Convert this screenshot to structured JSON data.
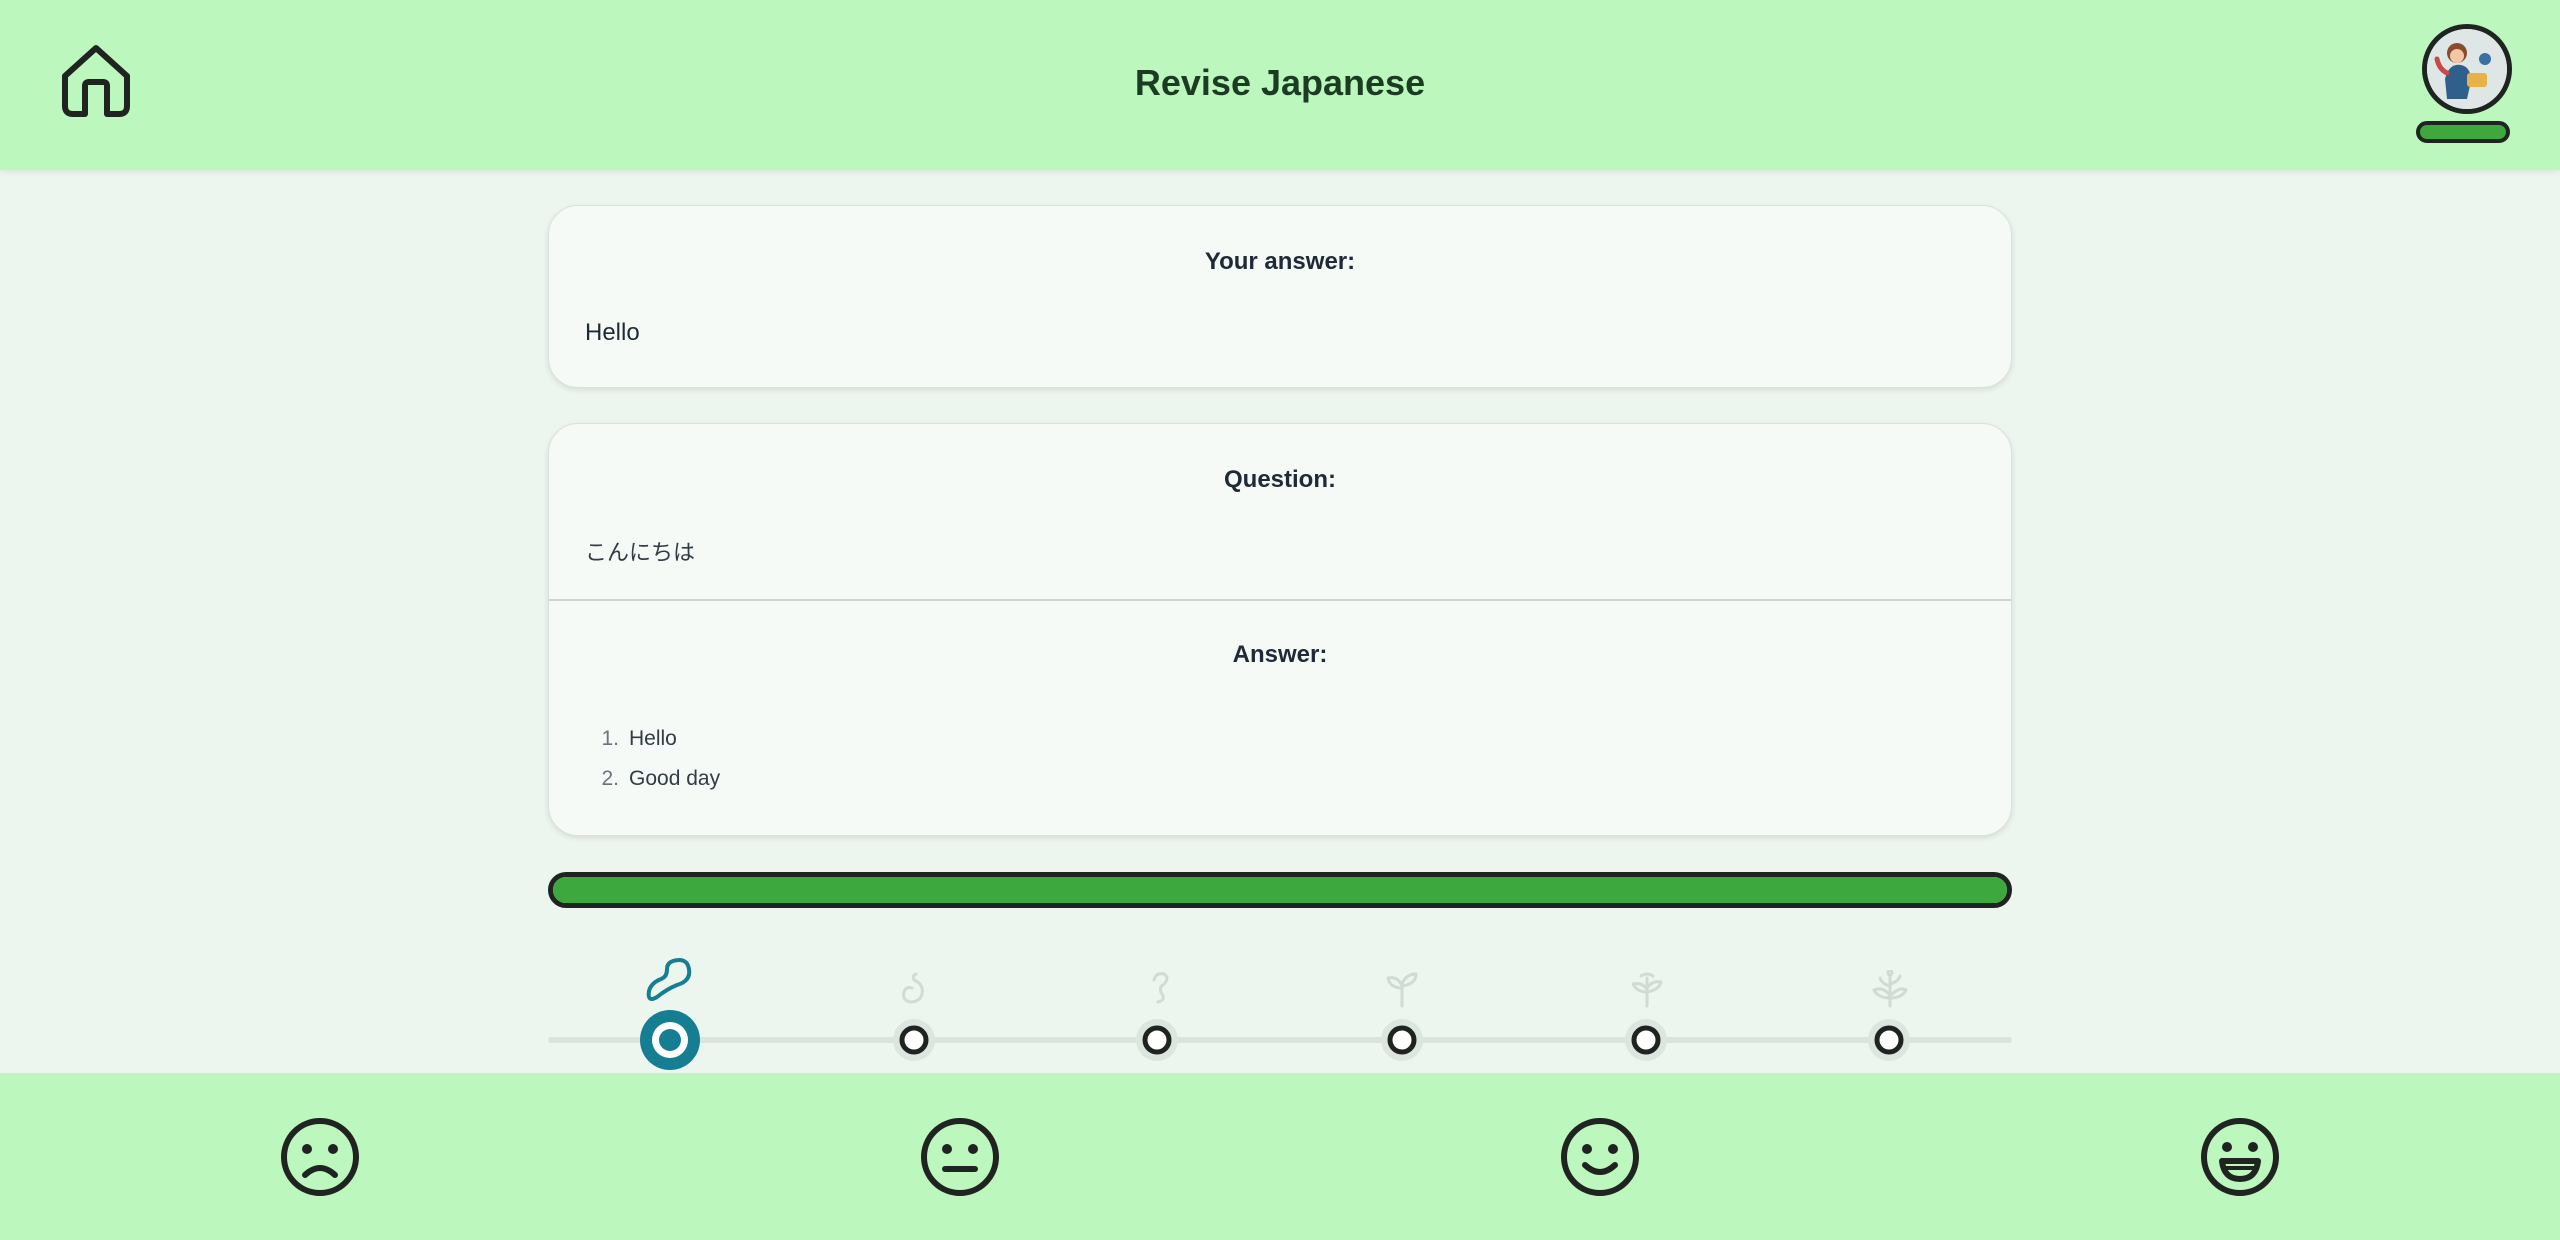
{
  "header": {
    "title": "Revise Japanese",
    "home_icon": "home-icon",
    "avatar": "user-avatar",
    "level_progress": 1.0
  },
  "user_answer": {
    "heading": "Your answer:",
    "text": "Hello"
  },
  "question": {
    "heading": "Question:",
    "text": "こんにちは"
  },
  "answer": {
    "heading": "Answer:",
    "items": [
      {
        "num": "1.",
        "text": "Hello"
      },
      {
        "num": "2.",
        "text": "Good day"
      }
    ]
  },
  "progress": {
    "fraction": 1.0,
    "color": "#3da83d"
  },
  "stages": {
    "active_index": 0,
    "active_color": "#167e93",
    "items": [
      {
        "icon": "seed-icon"
      },
      {
        "icon": "sprouting-seed-icon"
      },
      {
        "icon": "curled-sprout-icon"
      },
      {
        "icon": "seedling-icon"
      },
      {
        "icon": "young-plant-icon"
      },
      {
        "icon": "growing-plant-icon"
      }
    ]
  },
  "ratings": [
    {
      "icon": "sad-face-icon"
    },
    {
      "icon": "neutral-face-icon"
    },
    {
      "icon": "smile-face-icon"
    },
    {
      "icon": "grin-face-icon"
    }
  ],
  "colors": {
    "header_bg": "#bcf7bd",
    "page_bg": "#edf5ef",
    "card_bg": "#f5faf7",
    "progress_green": "#3da83d",
    "accent_teal": "#167e93"
  }
}
